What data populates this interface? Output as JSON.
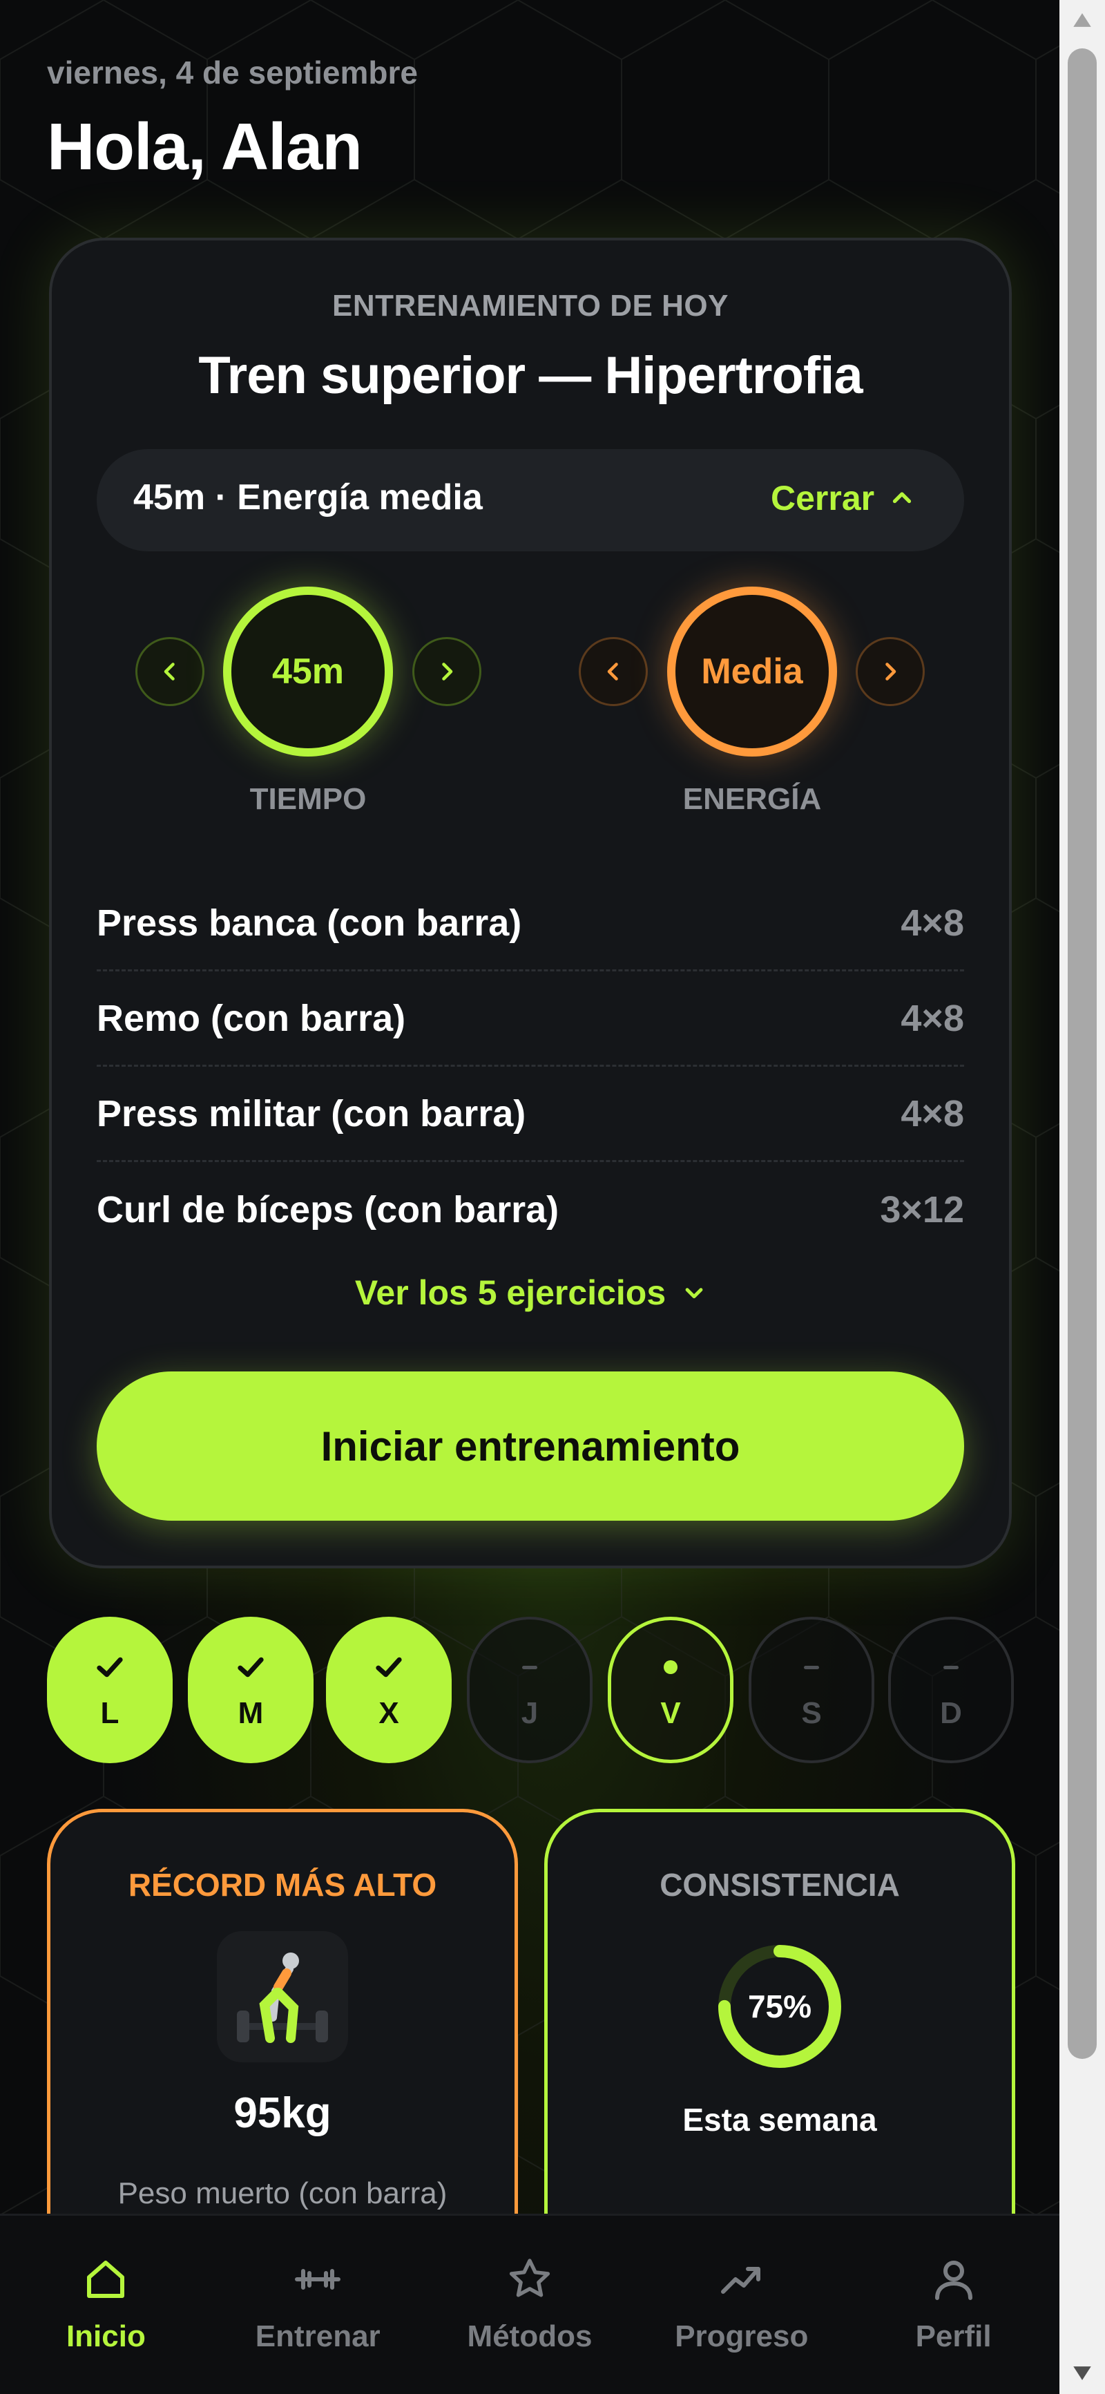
{
  "header": {
    "date": "viernes, 4 de septiembre",
    "greeting": "Hola, Alan"
  },
  "workout": {
    "eyebrow": "ENTRENAMIENTO DE HOY",
    "title": "Tren superior — Hipertrofia",
    "summary": "45m · Energía media",
    "close_label": "Cerrar",
    "time": {
      "value": "45m",
      "label": "TIEMPO"
    },
    "energy": {
      "value": "Media",
      "label": "ENERGÍA"
    },
    "exercises": [
      {
        "name": "Press banca (con barra)",
        "sets": "4×8"
      },
      {
        "name": "Remo (con barra)",
        "sets": "4×8"
      },
      {
        "name": "Press militar (con barra)",
        "sets": "4×8"
      },
      {
        "name": "Curl de bíceps (con barra)",
        "sets": "3×12"
      }
    ],
    "show_more": "Ver los 5 ejercicios",
    "start_label": "Iniciar entrenamiento"
  },
  "week": [
    {
      "day": "L",
      "status": "done"
    },
    {
      "day": "M",
      "status": "done"
    },
    {
      "day": "X",
      "status": "done"
    },
    {
      "day": "J",
      "status": "future"
    },
    {
      "day": "V",
      "status": "today"
    },
    {
      "day": "S",
      "status": "future"
    },
    {
      "day": "D",
      "status": "future"
    }
  ],
  "record": {
    "title": "RÉCORD MÁS ALTO",
    "value": "95kg",
    "exercise": "Peso muerto (con barra)",
    "icon": "deadlift-figure"
  },
  "consistency": {
    "title": "CONSISTENCIA",
    "percent": 75,
    "percent_label": "75%",
    "caption": "Esta semana"
  },
  "nav": [
    {
      "label": "Inicio",
      "icon": "home-icon",
      "active": true
    },
    {
      "label": "Entrenar",
      "icon": "dumbbell-icon",
      "active": false
    },
    {
      "label": "Métodos",
      "icon": "star-icon",
      "active": false
    },
    {
      "label": "Progreso",
      "icon": "trending-up-icon",
      "active": false
    },
    {
      "label": "Perfil",
      "icon": "user-icon",
      "active": false
    }
  ],
  "colors": {
    "accent": "#b5f53c",
    "orange": "#ff9a3c",
    "background": "#0a0b0c",
    "card": "#141619"
  }
}
